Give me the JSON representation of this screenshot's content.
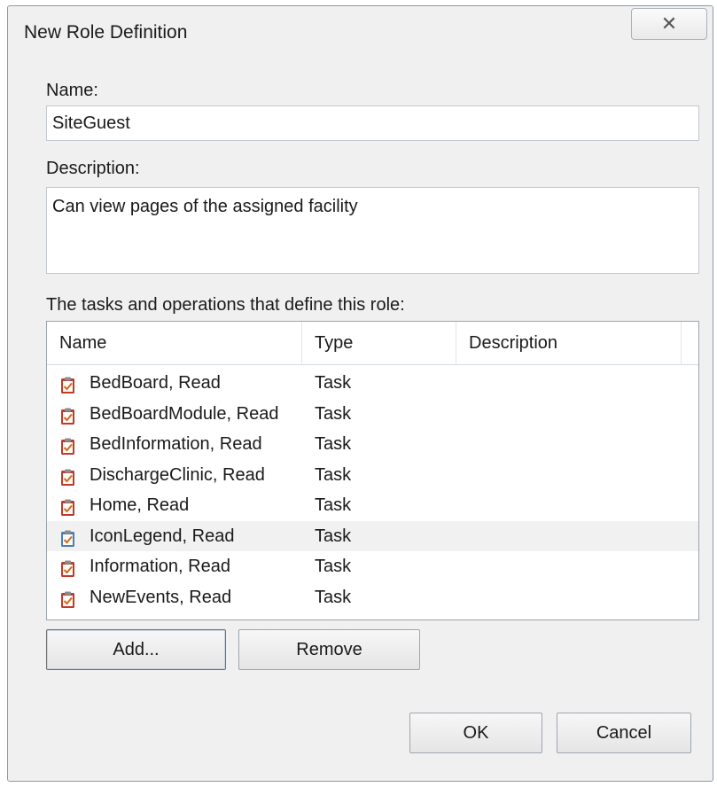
{
  "dialog": {
    "title": "New Role Definition",
    "close_glyph": "✕"
  },
  "name_field": {
    "label": "Name:",
    "value": "SiteGuest"
  },
  "description_field": {
    "label": "Description:",
    "value": "Can view pages of the assigned facility"
  },
  "tasks": {
    "label": "The tasks and operations that define this role:",
    "columns": [
      "Name",
      "Type",
      "Description"
    ],
    "rows": [
      {
        "name": "BedBoard, Read",
        "type": "Task",
        "description": "",
        "icon": "task-clipboard-icon",
        "selected": false
      },
      {
        "name": "BedBoardModule, Read",
        "type": "Task",
        "description": "",
        "icon": "task-clipboard-icon",
        "selected": false
      },
      {
        "name": "BedInformation, Read",
        "type": "Task",
        "description": "",
        "icon": "task-clipboard-icon",
        "selected": false
      },
      {
        "name": "DischargeClinic, Read",
        "type": "Task",
        "description": "",
        "icon": "task-clipboard-icon",
        "selected": false
      },
      {
        "name": "Home, Read",
        "type": "Task",
        "description": "",
        "icon": "task-clipboard-icon",
        "selected": false
      },
      {
        "name": "IconLegend, Read",
        "type": "Task",
        "description": "",
        "icon": "task-clipboard-icon",
        "selected": true
      },
      {
        "name": "Information, Read",
        "type": "Task",
        "description": "",
        "icon": "task-clipboard-icon",
        "selected": false
      },
      {
        "name": "NewEvents, Read",
        "type": "Task",
        "description": "",
        "icon": "task-clipboard-icon",
        "selected": false
      }
    ]
  },
  "buttons": {
    "add": "Add...",
    "remove": "Remove",
    "ok": "OK",
    "cancel": "Cancel"
  },
  "colors": {
    "dialog_bg": "#f0f0f0",
    "clipboard_red": "#c0392b",
    "clipboard_blue": "#4a7fb5"
  }
}
